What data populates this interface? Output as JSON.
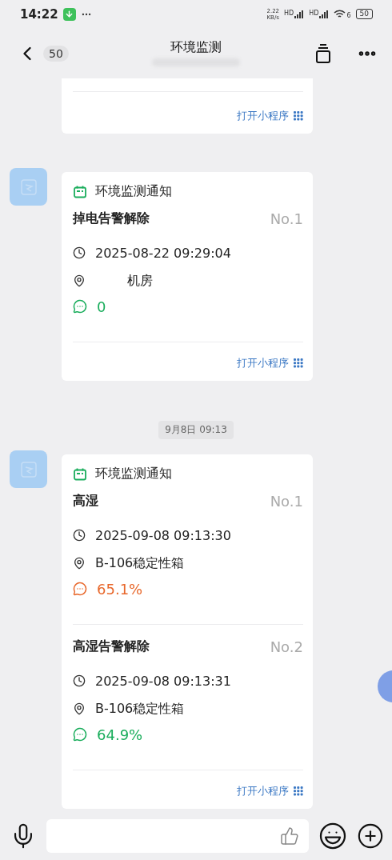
{
  "status_bar": {
    "time": "14:22",
    "speed_value": "2.22",
    "speed_unit": "KB/s",
    "network_labels": [
      "HD",
      "HD"
    ],
    "wifi_label": "6",
    "battery": "50"
  },
  "header": {
    "back_count": "50",
    "title": "环境监测"
  },
  "partial_card": {
    "link": "打开小程序"
  },
  "messages": [
    {
      "kind": "card",
      "header": "环境监测通知",
      "link": "打开小程序",
      "entries": [
        {
          "title": "掉电告警解除",
          "number": "No.1",
          "time": "2025-08-22 09:29:04",
          "location": "机房",
          "reading": "0",
          "color": "#1aad5c"
        }
      ]
    },
    {
      "kind": "time",
      "text": "9月8日 09:13"
    },
    {
      "kind": "card",
      "header": "环境监测通知",
      "link": "打开小程序",
      "entries": [
        {
          "title": "高湿",
          "number": "No.1",
          "time": "2025-09-08 09:13:30",
          "location": "B-106稳定性箱",
          "reading": "65.1%",
          "color": "#e8682c"
        },
        {
          "title": "高湿告警解除",
          "number": "No.2",
          "time": "2025-09-08 09:13:31",
          "location": "B-106稳定性箱",
          "reading": "64.9%",
          "color": "#1aad5c"
        }
      ]
    }
  ]
}
